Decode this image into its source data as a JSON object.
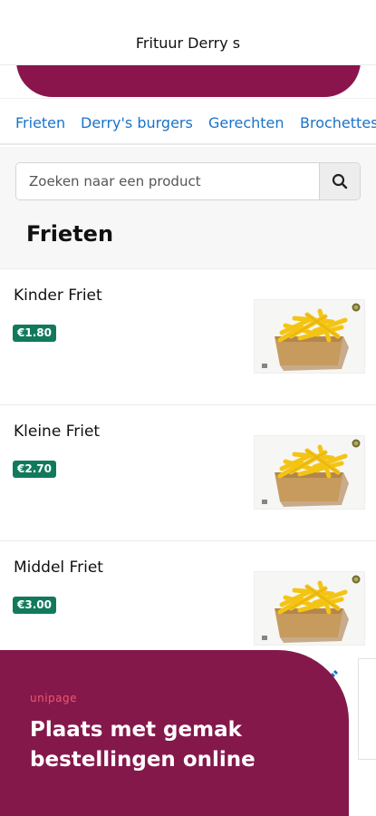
{
  "header": {
    "title": "Frituur Derry s"
  },
  "colors": {
    "brand": "#8a154d",
    "link": "#1a73c9",
    "price_badge": "#127a5c",
    "accent": "#f0576e"
  },
  "tabs": [
    {
      "label": "Frieten"
    },
    {
      "label": "Derry's burgers"
    },
    {
      "label": "Gerechten"
    },
    {
      "label": "Brochettes"
    }
  ],
  "search": {
    "placeholder": "Zoeken naar een product",
    "value": "",
    "icon": "search-icon"
  },
  "section": {
    "title": "Frieten"
  },
  "products": [
    {
      "name": "Kinder Friet",
      "price": "€1.80",
      "image": "fries-photo"
    },
    {
      "name": "Kleine Friet",
      "price": "€2.70",
      "image": "fries-photo"
    },
    {
      "name": "Middel Friet",
      "price": "€3.00",
      "image": "fries-photo"
    }
  ],
  "promo": {
    "brand": "unipage",
    "headline": "Plaats met gemak bestellingen online"
  }
}
